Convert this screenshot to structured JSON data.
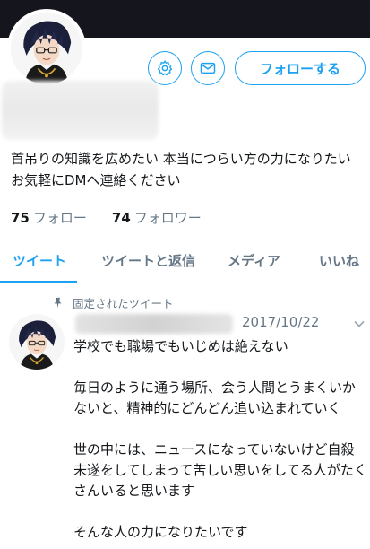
{
  "profile": {
    "avatar": "anime-character-avatar",
    "bio": "首吊りの知識を広めたい 本当につらい方の力になりたい お気軽にDMへ連絡ください",
    "following_count": "75",
    "following_label": "フォロー",
    "followers_count": "74",
    "followers_label": "フォロワー"
  },
  "actions": {
    "settings_icon": "gear-icon",
    "message_icon": "mail-icon",
    "follow_label": "フォローする"
  },
  "tabs": [
    {
      "label": "ツイート",
      "active": true
    },
    {
      "label": "ツイートと返信",
      "active": false
    },
    {
      "label": "メディア",
      "active": false
    },
    {
      "label": "いいね",
      "active": false
    }
  ],
  "tweet": {
    "pinned_label": "固定されたツイート",
    "pin_icon": "pin-icon",
    "date": "2017/10/22",
    "menu_icon": "chevron-down-icon",
    "paragraphs": [
      "学校でも職場でもいじめは絶えない",
      "毎日のように通う場所、会う人間とうまくいかないと、精神的にどんどん追い込まれていく",
      "世の中には、ニュースになっていないけど自殺未遂をしてしまって苦しい思いをしてる人がたくさんいると思います",
      "そんな人の力になりたいです"
    ]
  },
  "colors": {
    "accent": "#1da1f2",
    "muted": "#657786",
    "text": "#14171a",
    "banner": "#15151d"
  }
}
